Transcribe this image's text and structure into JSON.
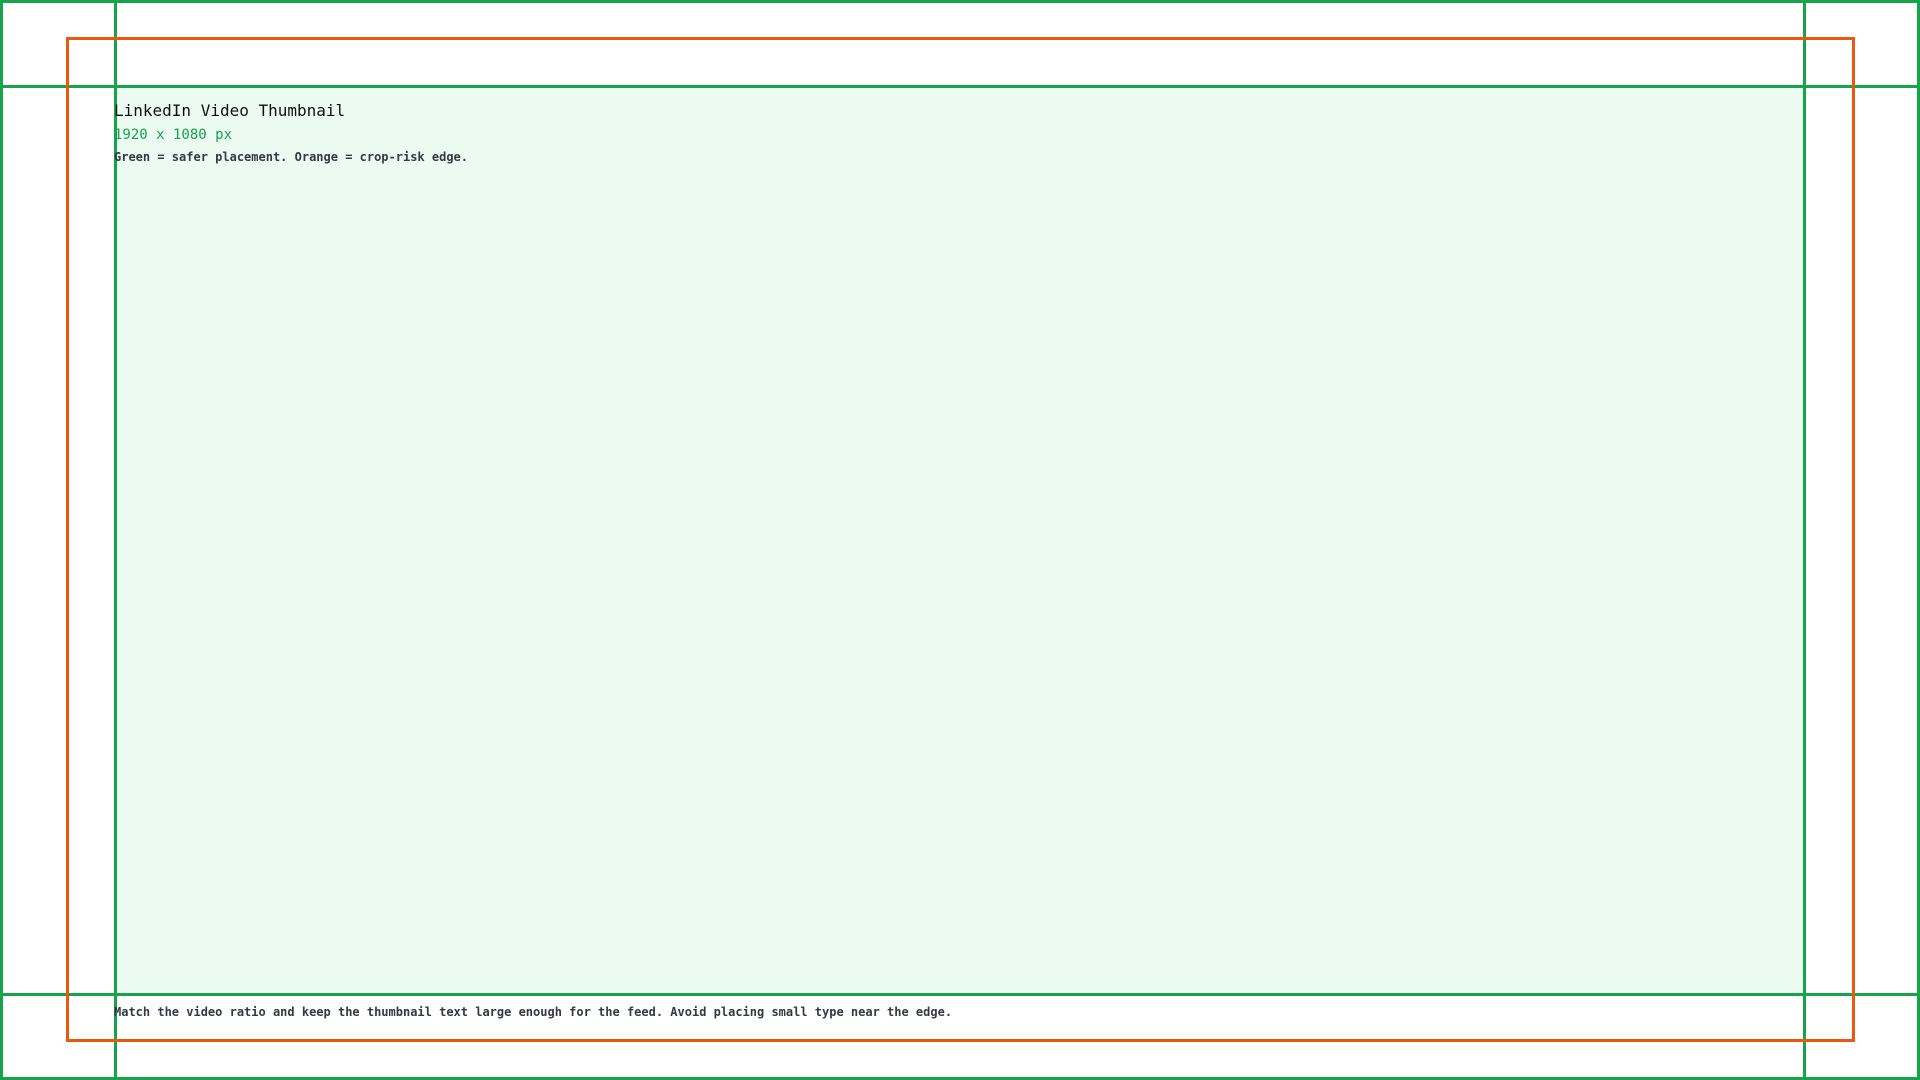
{
  "thumbnail": {
    "title": "LinkedIn Video Thumbnail",
    "dimensions": "1920 x 1080 px",
    "legend": "Green = safer placement. Orange = crop-risk edge.",
    "note": "Match the video ratio and keep the thumbnail text large enough for the feed. Avoid placing small type near the edge."
  },
  "colors": {
    "safe_guide": "#16a34a",
    "crop_edge": "#ea580c",
    "safe_fill": "#ebfbf2",
    "text": "#111111"
  }
}
